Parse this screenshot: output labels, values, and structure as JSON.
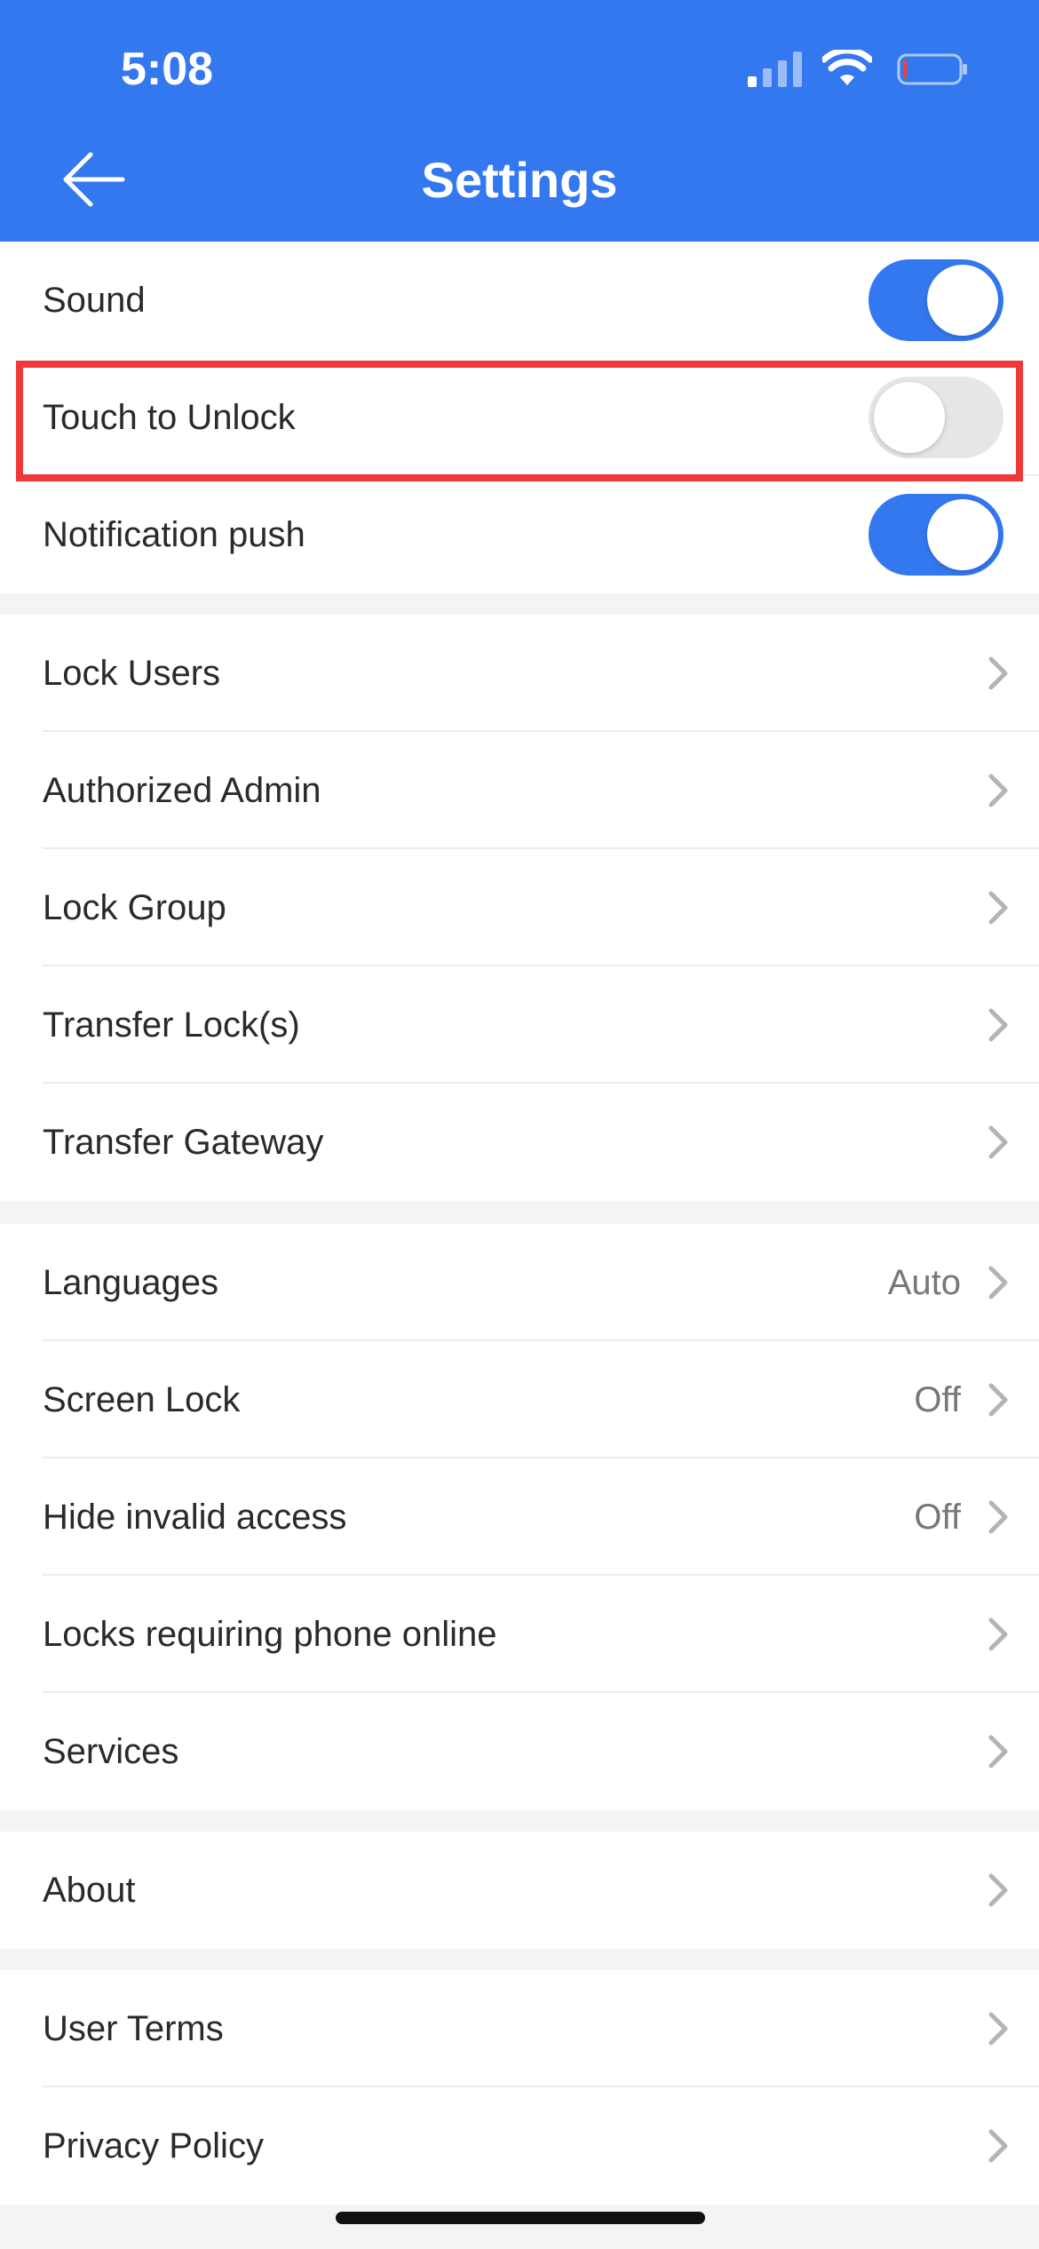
{
  "status_bar": {
    "time": "5:08",
    "icons": [
      "signal-icon",
      "wifi-icon",
      "battery-icon"
    ]
  },
  "header": {
    "title": "Settings",
    "back_icon": "back-arrow-icon",
    "background": "#3478f0"
  },
  "toggles": [
    {
      "label": "Sound",
      "state": "on"
    },
    {
      "label": "Touch to Unlock",
      "state": "off",
      "highlighted": true
    },
    {
      "label": "Notification push",
      "state": "on"
    }
  ],
  "lock_settings": [
    {
      "label": "Lock Users"
    },
    {
      "label": "Authorized Admin"
    },
    {
      "label": "Lock Group"
    },
    {
      "label": "Transfer Lock(s)"
    },
    {
      "label": "Transfer Gateway"
    }
  ],
  "app_settings": [
    {
      "label": "Languages",
      "value": "Auto"
    },
    {
      "label": "Screen Lock",
      "value": "Off"
    },
    {
      "label": "Hide invalid access",
      "value": "Off"
    },
    {
      "label": "Locks requiring phone online",
      "value": ""
    },
    {
      "label": "Services",
      "value": ""
    }
  ],
  "about": [
    {
      "label": "About"
    }
  ],
  "legal": [
    {
      "label": "User Terms"
    },
    {
      "label": "Privacy Policy"
    }
  ],
  "colors": {
    "accent": "#3478f0",
    "highlight": "#f0383a",
    "toggle_off": "#e6e6e8"
  }
}
